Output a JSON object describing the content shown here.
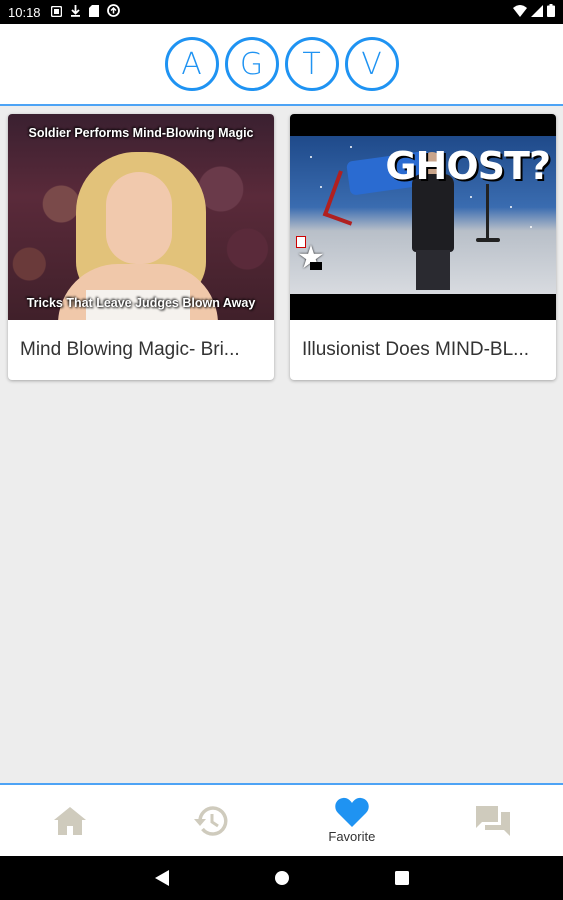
{
  "status_bar": {
    "time": "10:18",
    "left_icons": [
      "notification-icon",
      "download-icon",
      "sd-card-icon",
      "sync-icon"
    ],
    "right_icons": [
      "wifi-icon",
      "signal-icon",
      "battery-icon"
    ]
  },
  "header": {
    "logo_letters": [
      "A",
      "G",
      "T",
      "V"
    ],
    "accent_color": "#1f93f2"
  },
  "videos": [
    {
      "title": "Mind Blowing Magic- Bri...",
      "thumb_caption_top": "Soldier Performs Mind-Blowing Magic",
      "thumb_caption_bottom": "Tricks That Leave Judges Blown Away"
    },
    {
      "title": "Illusionist Does MIND-BL...",
      "thumb_caption_top": "GHOST?"
    }
  ],
  "bottom_nav": {
    "items": [
      {
        "icon": "home-icon",
        "label": ""
      },
      {
        "icon": "history-icon",
        "label": ""
      },
      {
        "icon": "heart-icon",
        "label": "Favorite"
      },
      {
        "icon": "chat-icon",
        "label": ""
      }
    ],
    "active_index": 2,
    "active_color": "#1f93f2",
    "inactive_color": "#cfcbbd"
  },
  "system_nav": [
    "back-icon",
    "home-circle-icon",
    "recents-icon"
  ]
}
